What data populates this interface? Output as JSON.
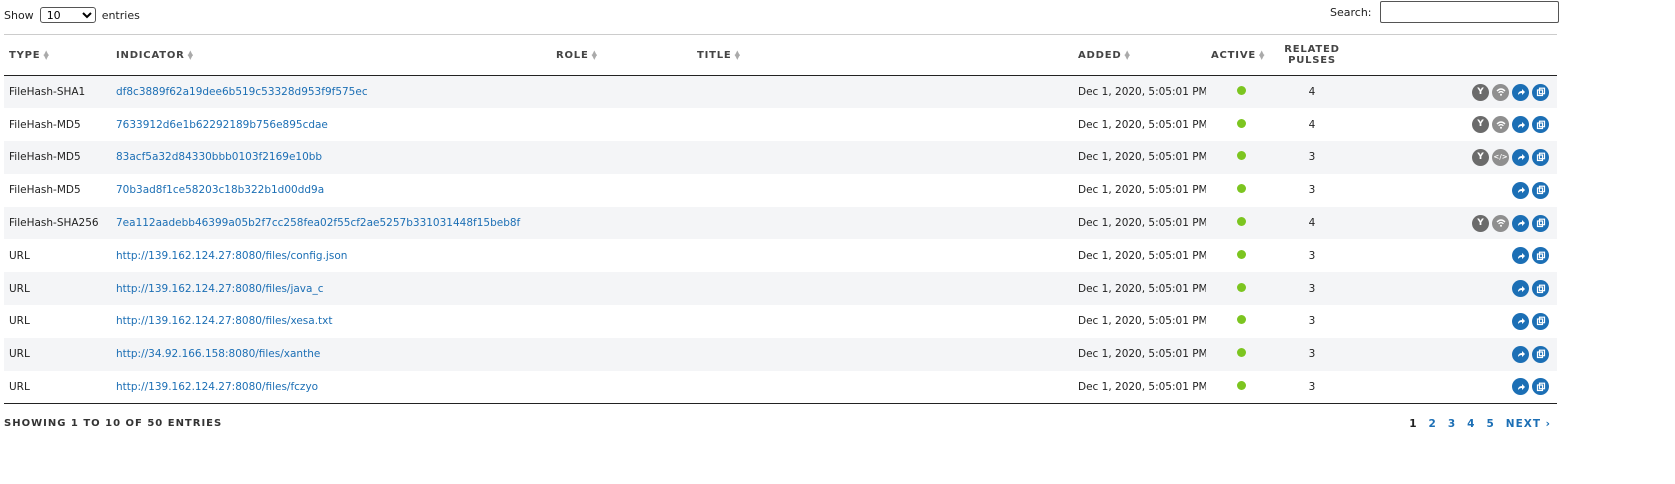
{
  "controls": {
    "show_label": "Show",
    "entries_value": "10",
    "entries_label": "entries",
    "search_label": "Search:",
    "search_value": ""
  },
  "table": {
    "headers": {
      "type": "TYPE",
      "indicator": "INDICATOR",
      "role": "ROLE",
      "title": "TITLE",
      "added": "ADDED",
      "active": "ACTIVE",
      "related_1": "RELATED",
      "related_2": "PULSES"
    },
    "rows": [
      {
        "type": "FileHash-SHA1",
        "indicator": "df8c3889f62a19dee6b519c53328d953f9f575ec",
        "role": "",
        "title": "",
        "added": "Dec 1, 2020, 5:05:01 PM",
        "pulses": "4",
        "icons": [
          "yara-icon",
          "wifi-icon",
          "share-icon",
          "copy-icon"
        ]
      },
      {
        "type": "FileHash-MD5",
        "indicator": "7633912d6e1b62292189b756e895cdae",
        "role": "",
        "title": "",
        "added": "Dec 1, 2020, 5:05:01 PM",
        "pulses": "4",
        "icons": [
          "yara-icon",
          "wifi-icon",
          "share-icon",
          "copy-icon"
        ]
      },
      {
        "type": "FileHash-MD5",
        "indicator": "83acf5a32d84330bbb0103f2169e10bb",
        "role": "",
        "title": "",
        "added": "Dec 1, 2020, 5:05:01 PM",
        "pulses": "3",
        "icons": [
          "yara-icon",
          "code-icon",
          "share-icon",
          "copy-icon"
        ]
      },
      {
        "type": "FileHash-MD5",
        "indicator": "70b3ad8f1ce58203c18b322b1d00dd9a",
        "role": "",
        "title": "",
        "added": "Dec 1, 2020, 5:05:01 PM",
        "pulses": "3",
        "icons": [
          "share-icon",
          "copy-icon"
        ]
      },
      {
        "type": "FileHash-SHA256",
        "indicator": "7ea112aadebb46399a05b2f7cc258fea02f55cf2ae5257b331031448f15beb8f",
        "role": "",
        "title": "",
        "added": "Dec 1, 2020, 5:05:01 PM",
        "pulses": "4",
        "icons": [
          "yara-icon",
          "wifi-icon",
          "share-icon",
          "copy-icon"
        ]
      },
      {
        "type": "URL",
        "indicator": "http://139.162.124.27:8080/files/config.json",
        "role": "",
        "title": "",
        "added": "Dec 1, 2020, 5:05:01 PM",
        "pulses": "3",
        "icons": [
          "share-icon",
          "copy-icon"
        ]
      },
      {
        "type": "URL",
        "indicator": "http://139.162.124.27:8080/files/java_c",
        "role": "",
        "title": "",
        "added": "Dec 1, 2020, 5:05:01 PM",
        "pulses": "3",
        "icons": [
          "share-icon",
          "copy-icon"
        ]
      },
      {
        "type": "URL",
        "indicator": "http://139.162.124.27:8080/files/xesa.txt",
        "role": "",
        "title": "",
        "added": "Dec 1, 2020, 5:05:01 PM",
        "pulses": "3",
        "icons": [
          "share-icon",
          "copy-icon"
        ]
      },
      {
        "type": "URL",
        "indicator": "http://34.92.166.158:8080/files/xanthe",
        "role": "",
        "title": "",
        "added": "Dec 1, 2020, 5:05:01 PM",
        "pulses": "3",
        "icons": [
          "share-icon",
          "copy-icon"
        ]
      },
      {
        "type": "URL",
        "indicator": "http://139.162.124.27:8080/files/fczyo",
        "role": "",
        "title": "",
        "added": "Dec 1, 2020, 5:05:01 PM",
        "pulses": "3",
        "icons": [
          "share-icon",
          "copy-icon"
        ]
      }
    ]
  },
  "footer": {
    "info": "SHOWING 1 TO 10 OF 50 ENTRIES",
    "pages": [
      "1",
      "2",
      "3",
      "4",
      "5"
    ],
    "current_page": "1",
    "next_label": "NEXT"
  },
  "colors": {
    "link": "#1c6fb5",
    "active_dot": "#7cc520",
    "icon_gray": "#6b6b6b"
  }
}
